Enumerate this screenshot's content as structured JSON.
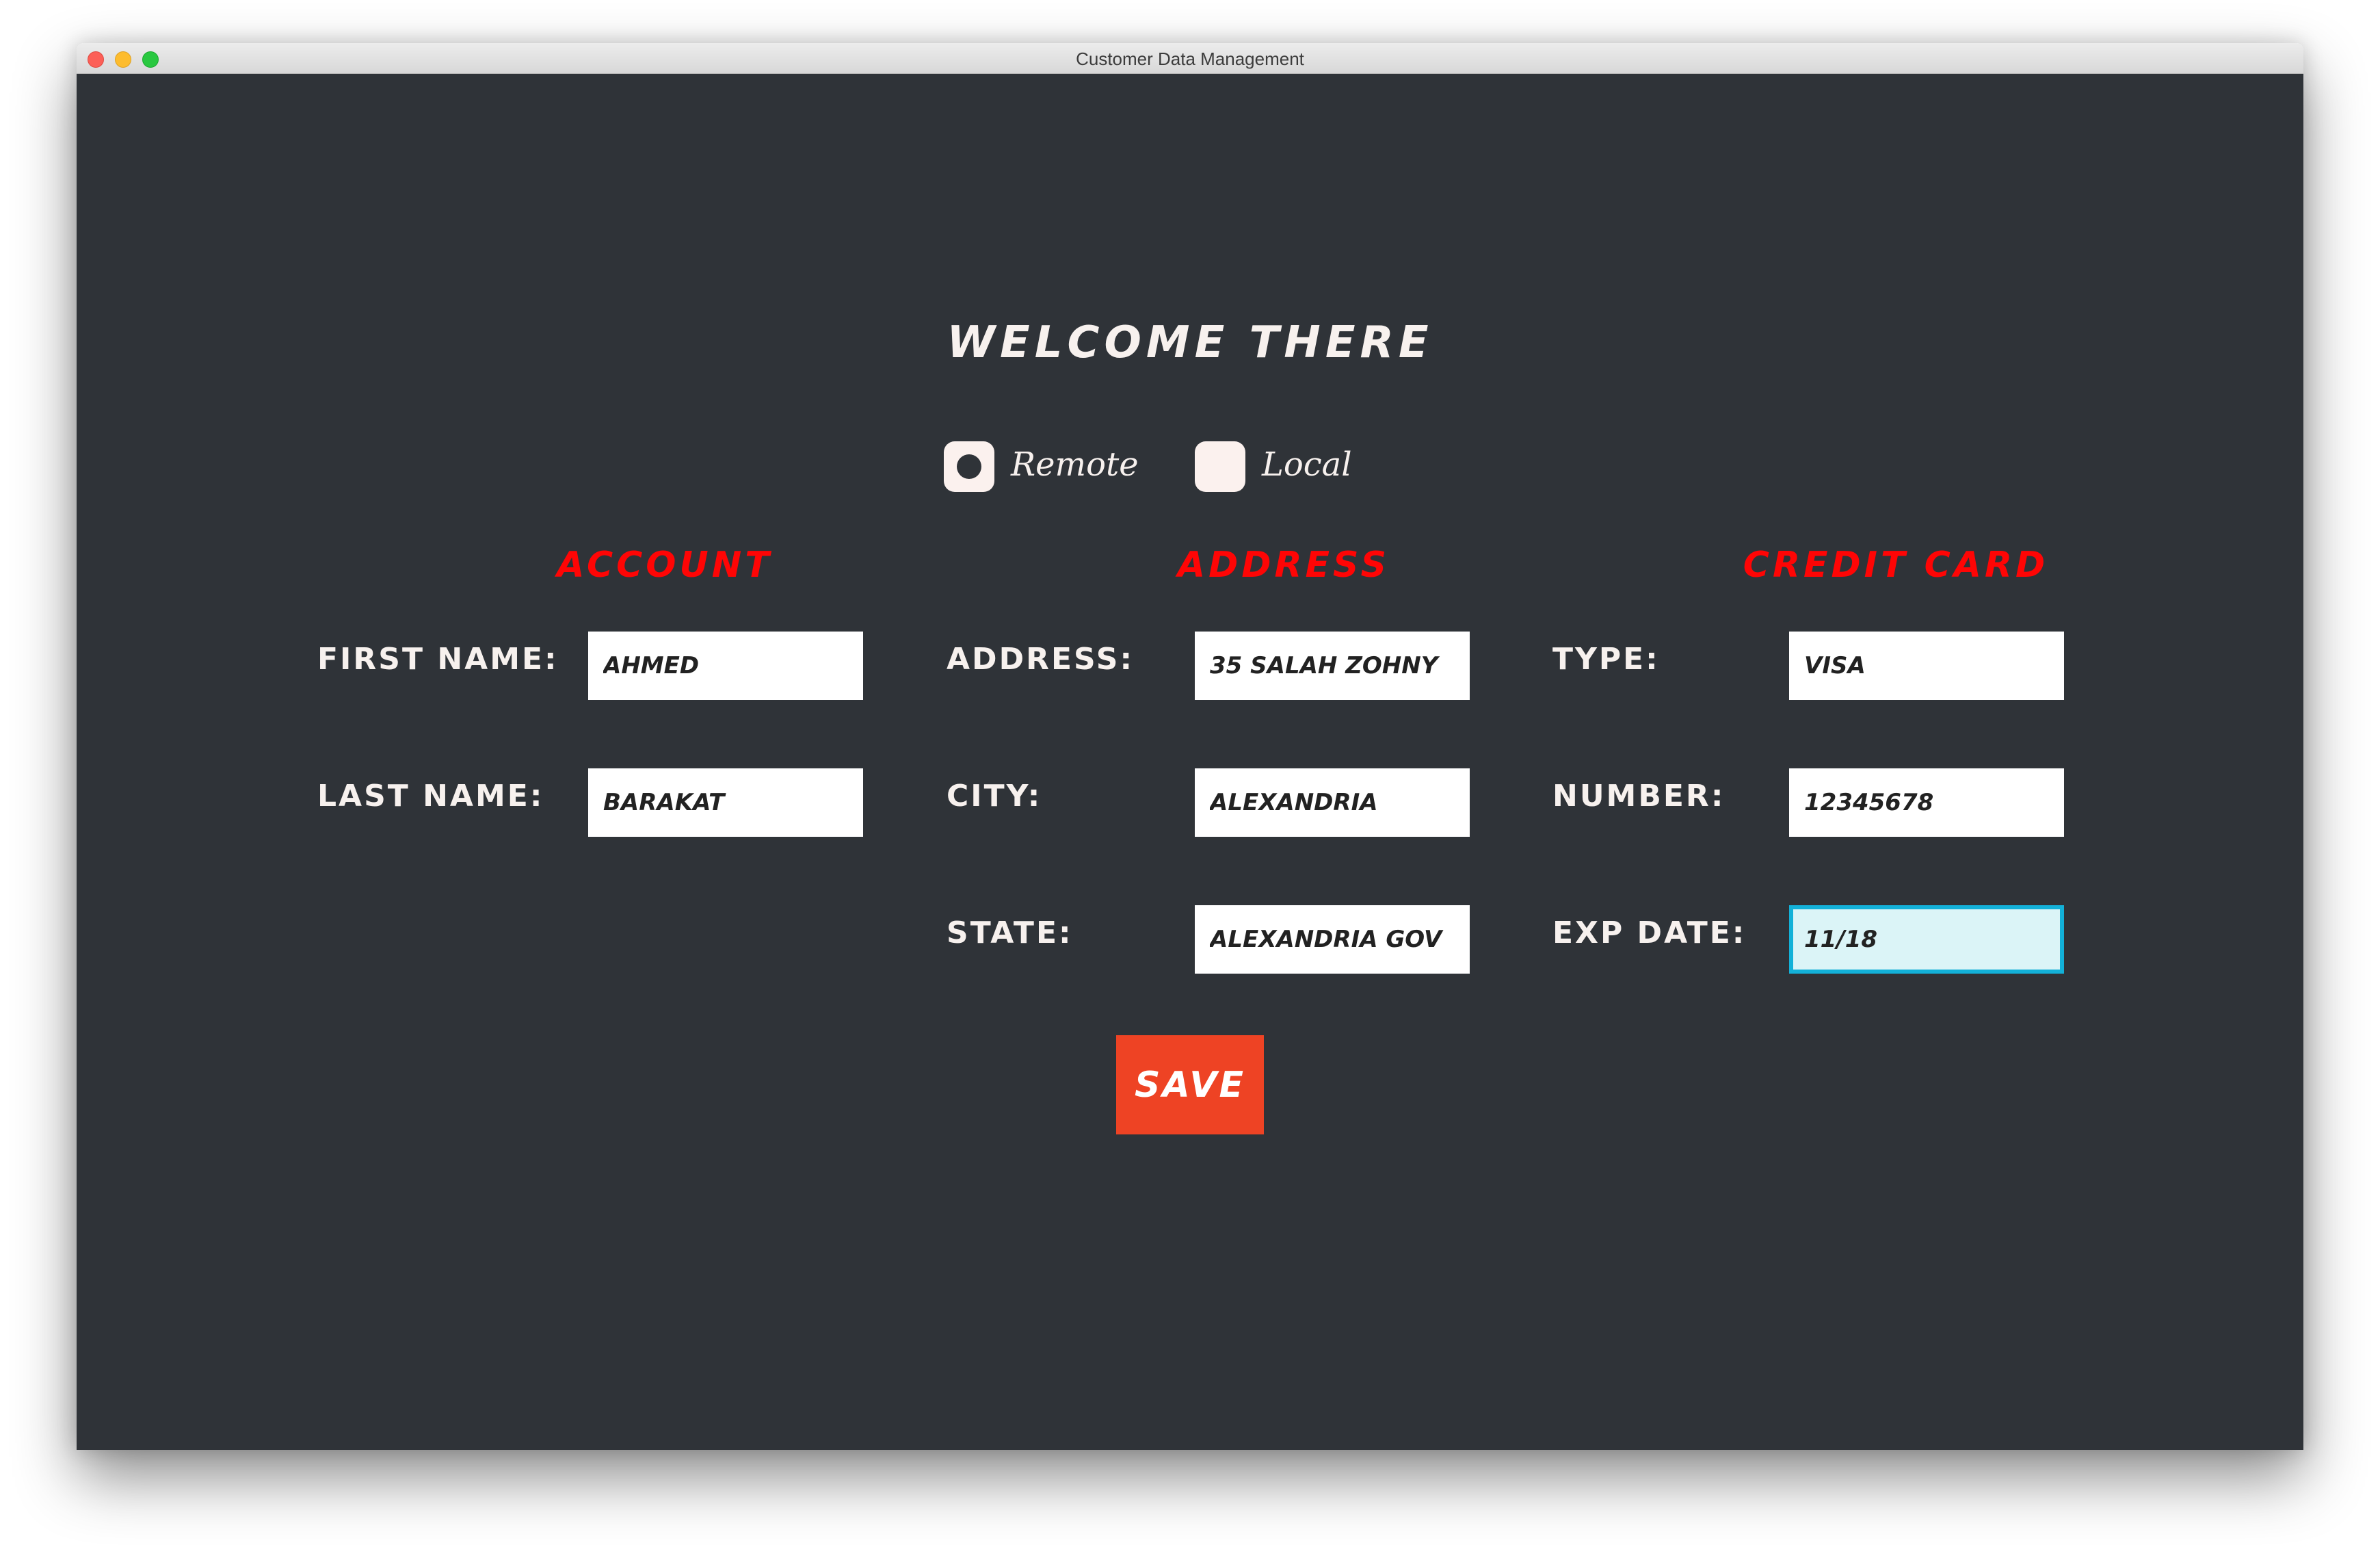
{
  "window": {
    "title": "Customer Data Management"
  },
  "header": {
    "welcome": "WELCOME THERE"
  },
  "storage": {
    "options": [
      {
        "label": "Remote",
        "selected": true
      },
      {
        "label": "Local",
        "selected": false
      }
    ]
  },
  "account": {
    "title": "ACCOUNT",
    "first_name_label": "FIRST NAME:",
    "first_name_value": "AHMED",
    "last_name_label": "LAST NAME:",
    "last_name_value": "BARAKAT"
  },
  "address": {
    "title": "ADDRESS",
    "address_label": "ADDRESS:",
    "address_value": "35 SALAH ZOHNY",
    "city_label": "CITY:",
    "city_value": "ALEXANDRIA",
    "state_label": "STATE:",
    "state_value": "ALEXANDRIA GOV"
  },
  "credit_card": {
    "title": "CREDIT CARD",
    "type_label": "TYPE:",
    "type_value": "VISA",
    "number_label": "NUMBER:",
    "number_value": "12345678",
    "exp_date_label": "EXP DATE:",
    "exp_date_value": "11/18"
  },
  "actions": {
    "save_label": "SAVE"
  },
  "colors": {
    "background": "#2f3338",
    "section_title": "#ff0505",
    "save_button": "#ee4324",
    "focus_border": "#13b1d8",
    "text_light": "#f7f1ee"
  }
}
